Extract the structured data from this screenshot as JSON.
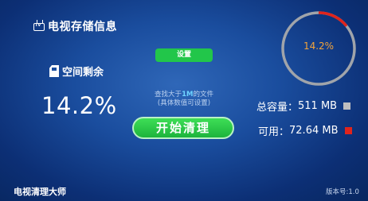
{
  "header": {
    "title": "电视存储信息",
    "icon": "tv-icon",
    "icon_text": "TV"
  },
  "storage": {
    "label": "空间剩余",
    "icon": "sd-card-icon",
    "percent": "14.2%"
  },
  "settings_button": {
    "label": "设置"
  },
  "hint": {
    "prefix": "查找大于",
    "size": "1M",
    "suffix": "的文件",
    "line2": "(具体数值可设置)"
  },
  "start_button": {
    "label": "开始清理"
  },
  "gauge": {
    "text": "14.2%",
    "used_fraction": 0.142
  },
  "stats": {
    "total_label": "总容量：",
    "total_value": "511 MB",
    "free_label": "可用：",
    "free_value": "72.64 MB"
  },
  "footer": {
    "app_name": "电视清理大师",
    "version": "版本号:1.0"
  },
  "colors": {
    "accent_green": "#22c64a",
    "gauge_used": "#e0241c",
    "gauge_track": "#a0a4aa",
    "gauge_text": "#f3a43a",
    "total_marker": "#bfbfbf",
    "free_marker": "#e0241c",
    "hint_highlight": "#6fd3ff"
  }
}
